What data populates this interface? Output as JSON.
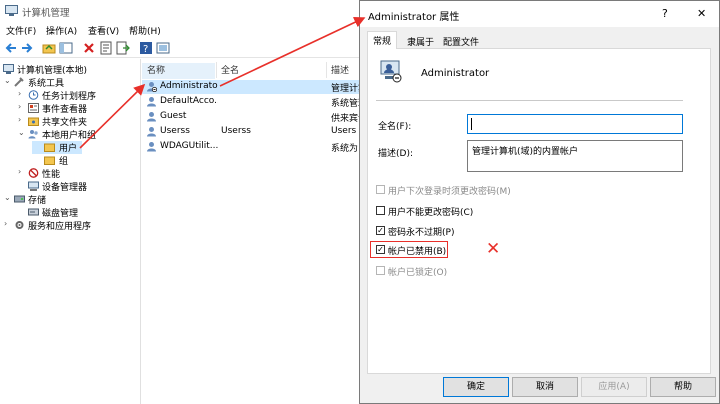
{
  "main": {
    "title": "计算机管理",
    "menu": [
      "文件(F)",
      "操作(A)",
      "查看(V)",
      "帮助(H)"
    ],
    "tree": {
      "root": "计算机管理(本地)",
      "system_tools": "系统工具",
      "task_scheduler": "任务计划程序",
      "event_viewer": "事件查看器",
      "shared_folders": "共享文件夹",
      "local_users_groups": "本地用户和组",
      "users": "用户",
      "groups": "组",
      "performance": "性能",
      "device_manager": "设备管理器",
      "storage": "存储",
      "disk_management": "磁盘管理",
      "services_apps": "服务和应用程序"
    },
    "list": {
      "headers": [
        "名称",
        "全名",
        "描述"
      ],
      "rows": [
        {
          "name": "Administrator",
          "fullname": "",
          "desc": "管理计算"
        },
        {
          "name": "DefaultAcco...",
          "fullname": "",
          "desc": "系统管理"
        },
        {
          "name": "Guest",
          "fullname": "",
          "desc": "供来宾访"
        },
        {
          "name": "Userss",
          "fullname": "Userss",
          "desc": "Users"
        },
        {
          "name": "WDAGUtilit...",
          "fullname": "",
          "desc": "系统为 W"
        }
      ]
    }
  },
  "dialog": {
    "title": "Administrator 属性",
    "help_btn": "?",
    "close_btn": "✕",
    "tabs": [
      "常规",
      "隶属于",
      "配置文件"
    ],
    "username": "Administrator",
    "fullname_label": "全名(F):",
    "fullname_value": "",
    "desc_label": "描述(D):",
    "desc_value": "管理计算机(域)的内置帐户",
    "checks": [
      {
        "label": "用户下次登录时须更改密码(M)",
        "checked": false,
        "disabled": true
      },
      {
        "label": "用户不能更改密码(C)",
        "checked": false,
        "disabled": false
      },
      {
        "label": "密码永不过期(P)",
        "checked": true,
        "disabled": false
      },
      {
        "label": "帐户已禁用(B)",
        "checked": true,
        "disabled": false
      },
      {
        "label": "帐户已锁定(O)",
        "checked": false,
        "disabled": true
      }
    ],
    "buttons": {
      "ok": "确定",
      "cancel": "取消",
      "apply": "应用(A)",
      "help": "帮助"
    }
  },
  "colors": {
    "annotation": "#e8302a",
    "selection": "#cce8ff",
    "accent": "#0078d7"
  },
  "annotation_mark": "✕"
}
